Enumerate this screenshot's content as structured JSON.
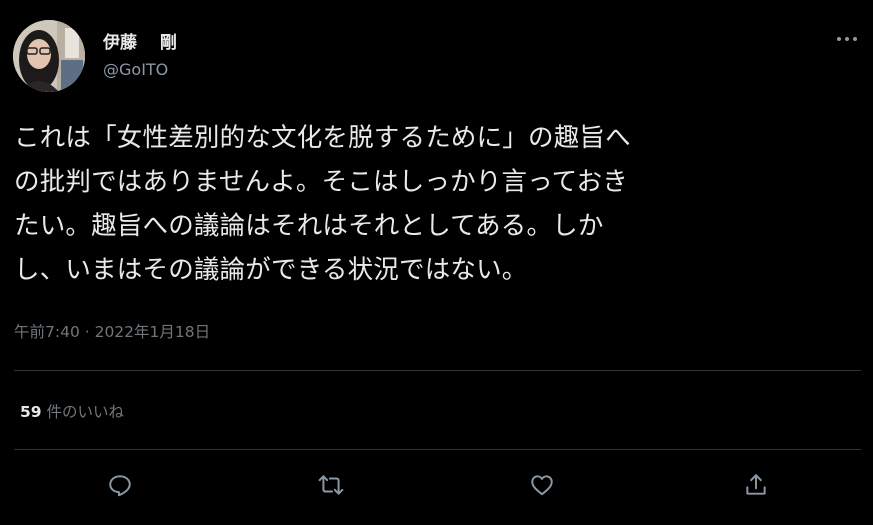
{
  "author": {
    "display_name": "伊藤　 剛",
    "handle": "@GoITO",
    "avatar_icon": "user-avatar-photo"
  },
  "tweet": {
    "lines": [
      "これは「女性差別的な文化を脱するために」の趣旨へ",
      "の批判ではありませんよ。そこはしっかり言っておき",
      "たい。趣旨への議論はそれはそれとしてある。しか",
      "し、いまはその議論ができる状況ではない。"
    ],
    "timestamp": "午前7:40 · 2022年1月18日"
  },
  "stats": {
    "likes_count": "59",
    "likes_label": " 件のいいね"
  },
  "icons": {
    "more": "more-options-icon",
    "reply": "reply-icon",
    "retweet": "retweet-icon",
    "like": "like-icon",
    "share": "share-icon"
  },
  "colors": {
    "background": "#000000",
    "text_primary": "#e7e9ea",
    "text_secondary": "#71767b",
    "divider": "#2f3336"
  }
}
